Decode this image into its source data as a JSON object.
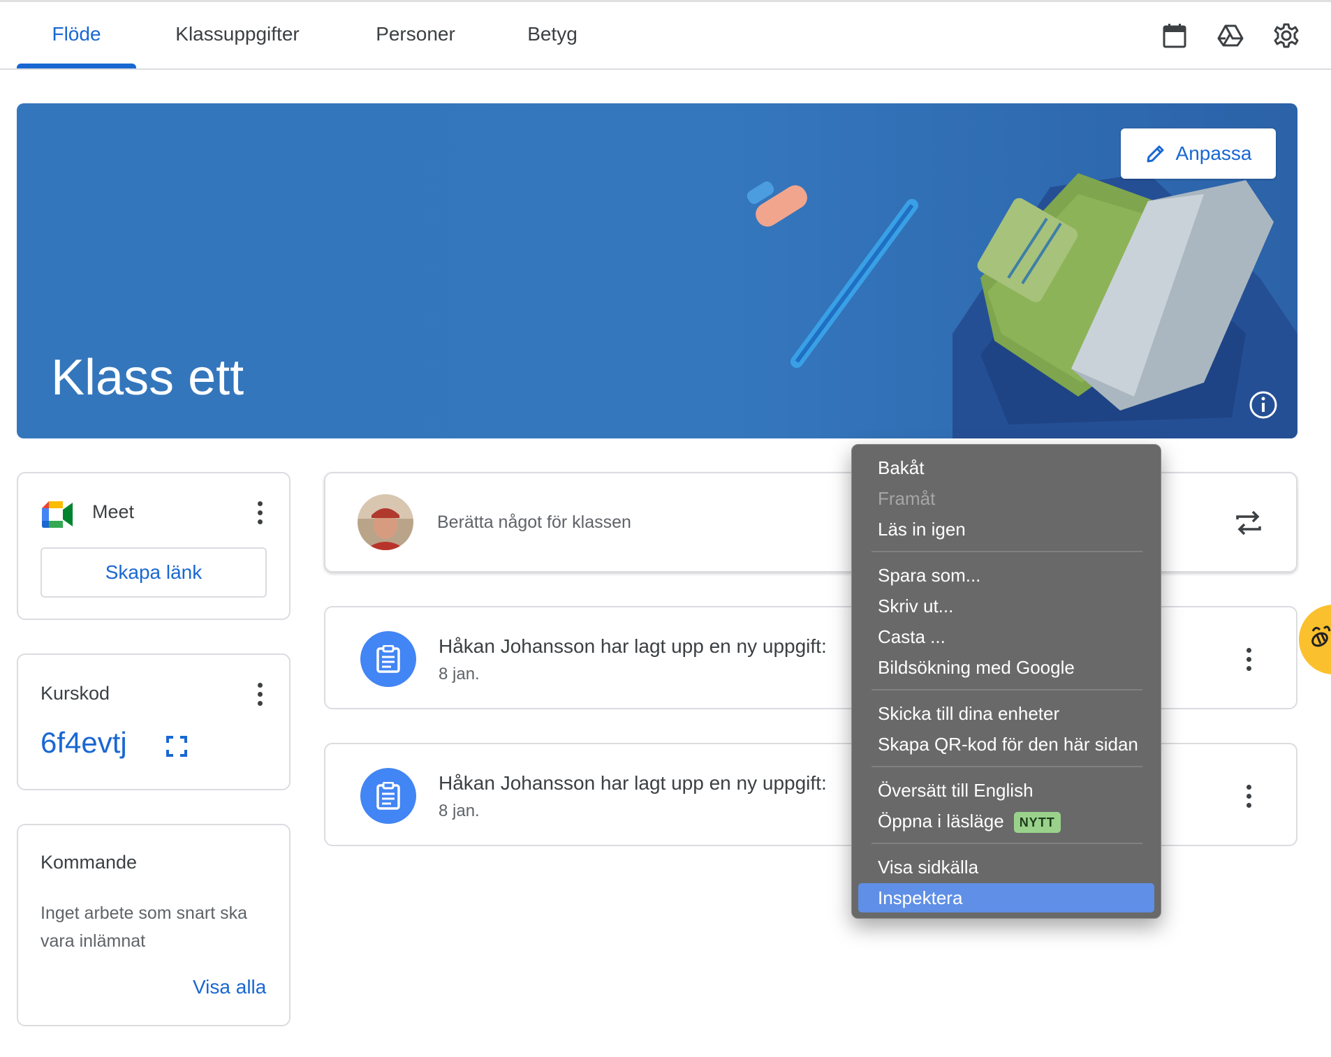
{
  "nav": {
    "tabs": [
      {
        "label": "Flöde"
      },
      {
        "label": "Klassuppgifter"
      },
      {
        "label": "Personer"
      },
      {
        "label": "Betyg"
      }
    ],
    "active_tab": "Flöde",
    "icons": [
      "calendar-icon",
      "drive-icon",
      "gear-icon"
    ]
  },
  "banner": {
    "title": "Klass ett",
    "customize_label": "Anpassa"
  },
  "meet": {
    "title": "Meet",
    "create_link_label": "Skapa länk"
  },
  "course_code": {
    "title": "Kurskod",
    "code": "6f4evtj"
  },
  "upcoming": {
    "title": "Kommande",
    "text": "Inget arbete som snart ska vara inlämnat",
    "view_all_label": "Visa alla"
  },
  "composer": {
    "placeholder": "Berätta något för klassen"
  },
  "posts": [
    {
      "title": "Håkan Johansson har lagt upp en ny uppgift:",
      "date": "8 jan."
    },
    {
      "title": "Håkan Johansson har lagt upp en ny uppgift:",
      "date": "8 jan."
    }
  ],
  "context_menu": {
    "items": {
      "back": "Bakåt",
      "forward": "Framåt",
      "reload": "Läs in igen",
      "save_as": "Spara som...",
      "print": "Skriv ut...",
      "cast": "Casta ...",
      "image_search": "Bildsökning med Google",
      "send_devices": "Skicka till dina enheter",
      "qr_code": "Skapa QR-kod för den här sidan",
      "translate": "Översätt till English",
      "reader_mode": "Öppna i läsläge",
      "reader_badge": "NYTT",
      "view_source": "Visa sidkälla",
      "inspect": "Inspektera"
    },
    "selected": "Inspektera"
  },
  "colors": {
    "accent": "#1967d2",
    "banner": "#3476bc",
    "menu_bg": "#696969",
    "menu_selected": "#5f8fe6",
    "badge": "#9ad28c"
  }
}
